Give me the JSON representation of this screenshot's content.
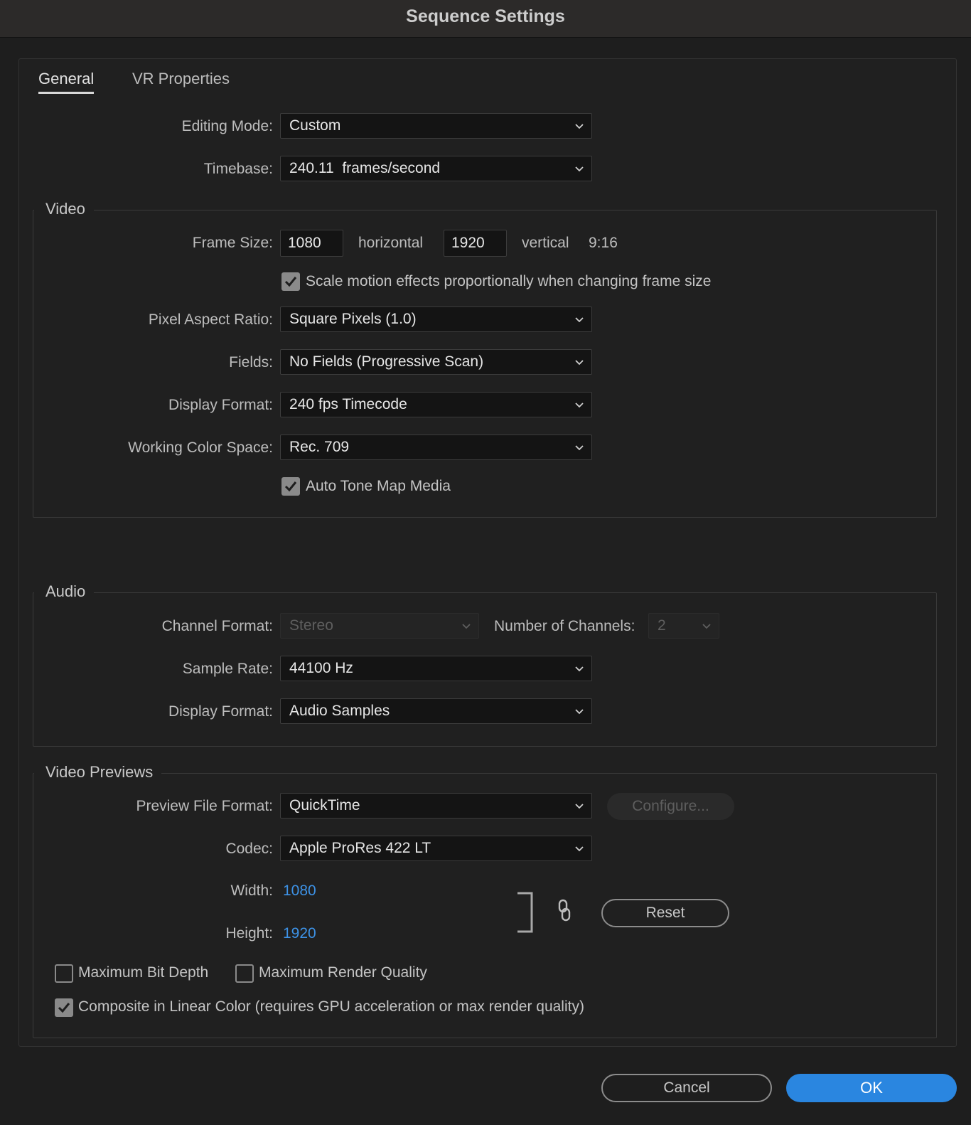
{
  "window": {
    "title": "Sequence Settings"
  },
  "tabs": [
    {
      "label": "General"
    },
    {
      "label": "VR Properties"
    }
  ],
  "general": {
    "editing_mode": {
      "label": "Editing Mode:",
      "value": "Custom"
    },
    "timebase": {
      "label": "Timebase:",
      "value": "240.11  frames/second"
    }
  },
  "video": {
    "title": "Video",
    "frame_size": {
      "label": "Frame Size:",
      "horizontal_value": "1080",
      "horizontal_label": "horizontal",
      "vertical_value": "1920",
      "vertical_label": "vertical",
      "aspect": "9:16"
    },
    "scale_motion": {
      "label": "Scale motion effects proportionally when changing frame size",
      "checked": true
    },
    "pixel_aspect_ratio": {
      "label": "Pixel Aspect Ratio:",
      "value": "Square Pixels (1.0)"
    },
    "fields": {
      "label": "Fields:",
      "value": "No Fields (Progressive Scan)"
    },
    "display_format": {
      "label": "Display Format:",
      "value": "240 fps Timecode"
    },
    "working_color_space": {
      "label": "Working Color Space:",
      "value": "Rec. 709"
    },
    "auto_tone_map": {
      "label": "Auto Tone Map Media",
      "checked": true
    }
  },
  "audio": {
    "title": "Audio",
    "channel_format": {
      "label": "Channel Format:",
      "value": "Stereo"
    },
    "number_of_channels": {
      "label": "Number of Channels:",
      "value": "2"
    },
    "sample_rate": {
      "label": "Sample Rate:",
      "value": "44100 Hz"
    },
    "display_format": {
      "label": "Display Format:",
      "value": "Audio Samples"
    }
  },
  "video_previews": {
    "title": "Video Previews",
    "preview_file_format": {
      "label": "Preview File Format:",
      "value": "QuickTime"
    },
    "configure_label": "Configure...",
    "codec": {
      "label": "Codec:",
      "value": "Apple ProRes 422 LT"
    },
    "width": {
      "label": "Width:",
      "value": "1080"
    },
    "height": {
      "label": "Height:",
      "value": "1920"
    },
    "reset_label": "Reset",
    "max_bit_depth": {
      "label": "Maximum Bit Depth",
      "checked": false
    },
    "max_render_quality": {
      "label": "Maximum Render Quality",
      "checked": false
    },
    "composite_linear": {
      "label": "Composite in Linear Color (requires GPU acceleration or max render quality)",
      "checked": true
    }
  },
  "footer": {
    "cancel_label": "Cancel",
    "ok_label": "OK"
  },
  "colors": {
    "accent": "#2a86e0",
    "link_value": "#3d92e6",
    "background": "#1e1e1e"
  }
}
